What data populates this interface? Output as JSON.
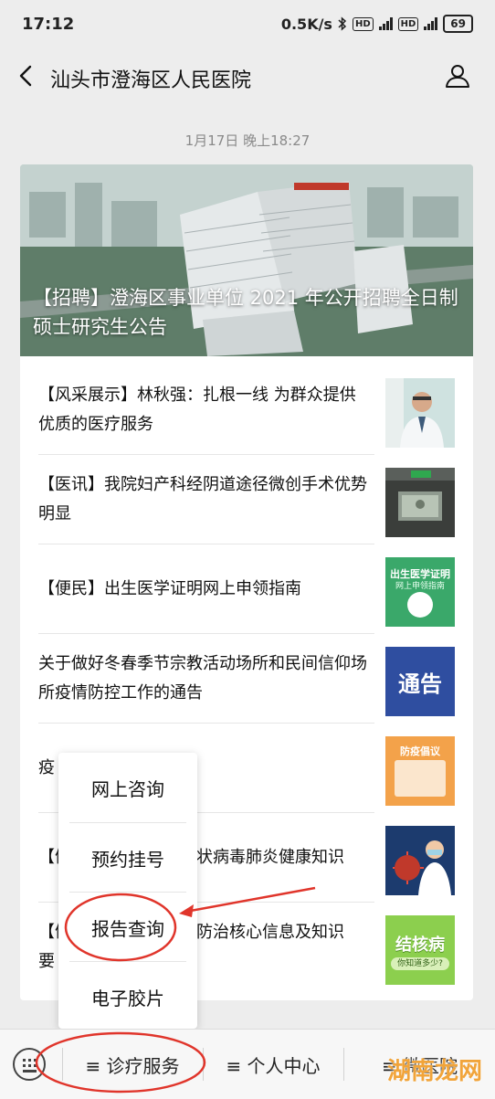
{
  "status": {
    "time": "17:12",
    "speed": "0.5K/s",
    "hd": "HD",
    "net": "4G",
    "battery": "69",
    "icons": [
      "bluetooth-icon",
      "signal-icon",
      "battery-icon"
    ]
  },
  "nav": {
    "title": "汕头市澄海区人民医院"
  },
  "message": {
    "timestamp": "1月17日 晚上18:27",
    "hero_title": "【招聘】澄海区事业单位 2021 年公开招聘全日制硕士研究生公告",
    "items": [
      {
        "title": "【风采展示】林秋强：扎根一线 为群众提供优质的医疗服务"
      },
      {
        "title": "【医讯】我院妇产科经阴道途径微创手术优势明显"
      },
      {
        "title": "【便民】出生医学证明网上申领指南"
      },
      {
        "title": "关于做好冬春季节宗教活动场所和民间信仰场所疫情防控工作的通告"
      },
      {
        "title": "疫"
      },
      {
        "title": "【健",
        "title_right": "状病毒肺炎健康知识"
      },
      {
        "title": "【健",
        "title_line2": "要",
        "title_right": "防治核心信息及知识"
      }
    ]
  },
  "thumbs": {
    "birth_cert": "出生医学证明",
    "birth_cert_sub": "网上申领指南",
    "notice": "通告",
    "tb": "结核病",
    "tb_sub": "你知道多少?",
    "epidemic": "防疫倡议"
  },
  "menu": {
    "items": [
      "网上咨询",
      "预约挂号",
      "报告查询",
      "电子胶片"
    ]
  },
  "bottombar": {
    "tabs": [
      "≡ 诊疗服务",
      "≡ 个人中心",
      "≡ 微医院"
    ]
  },
  "watermark": "湖南龙网",
  "colors": {
    "annotation": "#e0352b",
    "background": "#ededed",
    "notice_blue": "#2f4ea0",
    "cert_green": "#3aa86a"
  }
}
